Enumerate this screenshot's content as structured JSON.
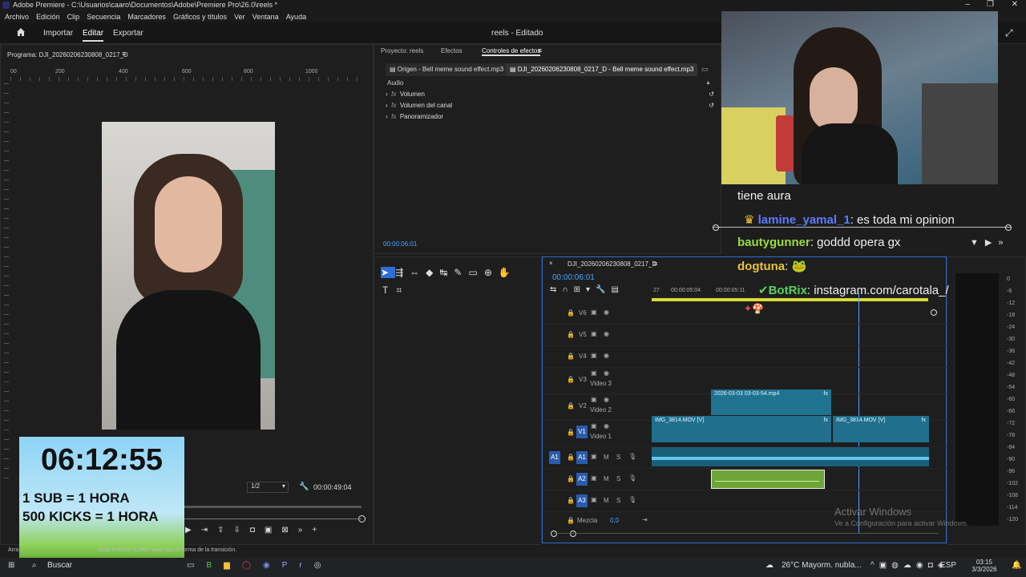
{
  "window": {
    "title": "Adobe Premiere - C:\\Usuarios\\caaro\\Documentos\\Adobe\\Premiere Pro\\26.0\\reels *"
  },
  "menu": [
    "Archivo",
    "Edición",
    "Clip",
    "Secuencia",
    "Marcadores",
    "Gráficos y títulos",
    "Ver",
    "Ventana",
    "Ayuda"
  ],
  "header": {
    "importar": "Importar",
    "editar": "Editar",
    "exportar": "Exportar",
    "project_state": "reels - Editado"
  },
  "program": {
    "label": "Programa: DJI_20260206230808_0217_D",
    "ruler": [
      "00",
      "200",
      "400",
      "600",
      "800",
      "1000"
    ],
    "quality": "1/2",
    "duration": "00:00:49:04"
  },
  "effects_panel": {
    "tabs": [
      "Proyecto: reels",
      "Efectos",
      "Controles de efectos"
    ],
    "source_tab": "Origen - Bell meme sound effect.mp3",
    "sequence_tab": "DJI_20260206230808_0217_D - Bell meme sound effect.mp3",
    "section": "Audio",
    "rows": [
      "Volumen",
      "Volumen del canal",
      "Panoramizador"
    ],
    "timecode": "00:00:06:01"
  },
  "timeline": {
    "name": "DJI_20260206230808_0217_D",
    "timecode": "00:00:06:01",
    "ruler": [
      "27",
      "00:00:05:04",
      "00:00:05:11"
    ],
    "video_tracks": [
      {
        "id": "V6",
        "label": ""
      },
      {
        "id": "V5",
        "label": ""
      },
      {
        "id": "V4",
        "label": ""
      },
      {
        "id": "V3",
        "label": "Video 3"
      },
      {
        "id": "V2",
        "label": "Video 2"
      },
      {
        "id": "V1",
        "label": "Video 1"
      }
    ],
    "audio_tracks": [
      "A1",
      "A2",
      "A3"
    ],
    "mix_label": "Mezcla",
    "mix_value": "0,0",
    "clips": {
      "v2": "2026-03-03 03-03-54.mp4",
      "v1a": "IMG_3814.MOV [V]",
      "v1b": "IMG_3814.MOV [V]"
    }
  },
  "status_hint": "Arra                                                   sada la tecla <CMD> para fijar la forma de la transición.",
  "overlay": {
    "timer": "06:12:55",
    "line1": "1 SUB = 1 HORA",
    "line2": "500 KICKS = 1 HORA"
  },
  "chat": [
    {
      "user": "",
      "text": "tiene aura",
      "color": "#ffffff"
    },
    {
      "user": "lamine_yamal_1",
      "text": ": es toda mi opinion",
      "color": "#5b7bff"
    },
    {
      "user": "bautygunner",
      "text": ": goddd opera gx",
      "color": "#9bdc3c"
    },
    {
      "user": "dogtuna",
      "text": ":",
      "color": "#e8c43a"
    },
    {
      "user": "BotRix",
      "text": ": instagram.com/carotala_/",
      "color": "#5cd05c"
    }
  ],
  "watermark": {
    "line1": "Activar Windows",
    "line2": "Ve a Configuración para activar Windows."
  },
  "meter_labels": [
    "0",
    "-6",
    "-12",
    "-18",
    "-24",
    "-30",
    "-36",
    "-42",
    "-48",
    "-54",
    "-60",
    "-66",
    "-72",
    "-78",
    "-84",
    "-90",
    "-96",
    "-102",
    "-108",
    "-114",
    "-120"
  ],
  "taskbar": {
    "search": "Buscar",
    "weather": "26°C  Mayorm. nubla...",
    "lang": "ESP",
    "time": "03:15",
    "date": "3/3/2026"
  }
}
